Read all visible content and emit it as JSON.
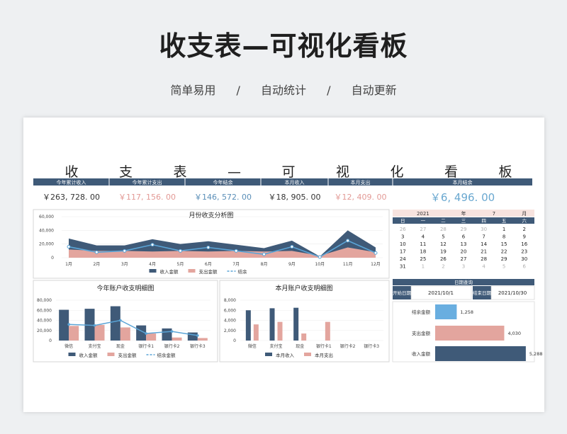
{
  "hero": {
    "title": "收支表—可视化看板",
    "tags": [
      "简单易用",
      "/",
      "自动统计",
      "/",
      "自动更新"
    ]
  },
  "sheet": {
    "banner_chars": [
      "收",
      "支",
      "表",
      "—",
      "可",
      "视",
      "化",
      "看",
      "板"
    ],
    "kpi": [
      {
        "label": "今年累计收入",
        "value": "￥263, 728. 00",
        "color": "#333333"
      },
      {
        "label": "今年累计支出",
        "value": "￥117, 156. 00",
        "color": "#e39a96"
      },
      {
        "label": "今年结余",
        "value": "￥146, 572. 00",
        "color": "#5b8fb8"
      },
      {
        "label": "本月收入",
        "value": "￥18, 905. 00",
        "color": "#333333"
      },
      {
        "label": "本月支出",
        "value": "￥12, 409. 00",
        "color": "#e39a96"
      },
      {
        "label": "本月结余",
        "value": "￥6, 496. 00",
        "color": "#6aa8d0"
      }
    ],
    "calendar": {
      "year": "2021",
      "year_unit": "年",
      "month": "7",
      "month_unit": "月",
      "weekdays": [
        "日",
        "一",
        "二",
        "三",
        "四",
        "五",
        "六"
      ],
      "rows": [
        [
          "26",
          "27",
          "28",
          "29",
          "30",
          "1",
          "2"
        ],
        [
          "3",
          "4",
          "5",
          "6",
          "7",
          "8",
          "9"
        ],
        [
          "10",
          "11",
          "12",
          "13",
          "14",
          "15",
          "16"
        ],
        [
          "17",
          "18",
          "19",
          "20",
          "21",
          "22",
          "23"
        ],
        [
          "24",
          "25",
          "26",
          "27",
          "28",
          "29",
          "30"
        ],
        [
          "31",
          "1",
          "2",
          "3",
          "4",
          "5",
          "6"
        ]
      ],
      "faded": [
        [
          true,
          true,
          true,
          true,
          true,
          false,
          false
        ],
        [
          false,
          false,
          false,
          false,
          false,
          false,
          false
        ],
        [
          false,
          false,
          false,
          false,
          false,
          false,
          false
        ],
        [
          false,
          false,
          false,
          false,
          false,
          false,
          false
        ],
        [
          false,
          false,
          false,
          false,
          false,
          false,
          false
        ],
        [
          false,
          true,
          true,
          true,
          true,
          true,
          true
        ]
      ]
    },
    "date_query": {
      "title": "日期查询",
      "start_label": "开始日期",
      "start_value": "2021/10/1",
      "end_label": "结束日期",
      "end_value": "2021/10/30"
    }
  },
  "colors": {
    "income": "#3f5a78",
    "expense": "#e3a59e",
    "balance": "#5aa4d6",
    "header": "#3f5a78"
  },
  "chart_data": [
    {
      "type": "area",
      "title": "月份收支分析图",
      "categories": [
        "1月",
        "2月",
        "3月",
        "4月",
        "5月",
        "6月",
        "7月",
        "8月",
        "9月",
        "10月",
        "11月",
        "12月"
      ],
      "yticks": [
        "0",
        "20,000",
        "40,000",
        "60,000"
      ],
      "ylim": [
        0,
        60000
      ],
      "series": [
        {
          "name": "收入金额",
          "values": [
            28000,
            18000,
            18000,
            27000,
            20000,
            24000,
            19000,
            14000,
            25000,
            2000,
            40000,
            15000
          ]
        },
        {
          "name": "支出金额",
          "values": [
            12000,
            10000,
            10000,
            9000,
            10000,
            9000,
            10000,
            9000,
            10000,
            3000,
            15000,
            8000
          ]
        },
        {
          "name": "结余",
          "values": [
            16000,
            8000,
            10000,
            19000,
            10000,
            15000,
            10000,
            5000,
            16000,
            1000,
            25000,
            7000
          ]
        }
      ],
      "legend": "bottom"
    },
    {
      "type": "bar",
      "title": "今年账户收支明细图",
      "categories": [
        "微信",
        "支付宝",
        "现金",
        "银行卡1",
        "银行卡2",
        "银行卡3"
      ],
      "yticks": [
        "0",
        "20,000",
        "40,000",
        "60,000",
        "80,000"
      ],
      "ylim": [
        0,
        80000
      ],
      "series": [
        {
          "name": "收入金额",
          "values": [
            61000,
            63000,
            68000,
            30000,
            24000,
            16000
          ]
        },
        {
          "name": "支出金额",
          "values": [
            29000,
            31000,
            26000,
            14000,
            6000,
            5000
          ]
        },
        {
          "name": "结余金额",
          "values": [
            32000,
            30000,
            40000,
            14000,
            18000,
            10000
          ]
        }
      ],
      "legend": "bottom"
    },
    {
      "type": "bar",
      "title": "本月账户收支明细图",
      "categories": [
        "微信",
        "支付宝",
        "现金",
        "银行卡1",
        "银行卡2",
        "银行卡3"
      ],
      "yticks": [
        "0",
        "2,000",
        "4,000",
        "6,000",
        "8,000"
      ],
      "ylim": [
        0,
        8000
      ],
      "series": [
        {
          "name": "本月收入",
          "values": [
            6000,
            6400,
            6500,
            0,
            0,
            0
          ]
        },
        {
          "name": "本月支出",
          "values": [
            3200,
            3700,
            1400,
            3700,
            0,
            0
          ]
        }
      ],
      "legend": "bottom"
    },
    {
      "type": "bar",
      "orientation": "horizontal",
      "categories": [
        "结余金额",
        "支出金额",
        "收入金额"
      ],
      "values": [
        1258,
        4030,
        5288
      ],
      "value_labels": [
        "1,258",
        "4,030",
        "5,288"
      ],
      "xlim": [
        0,
        5500
      ]
    }
  ]
}
